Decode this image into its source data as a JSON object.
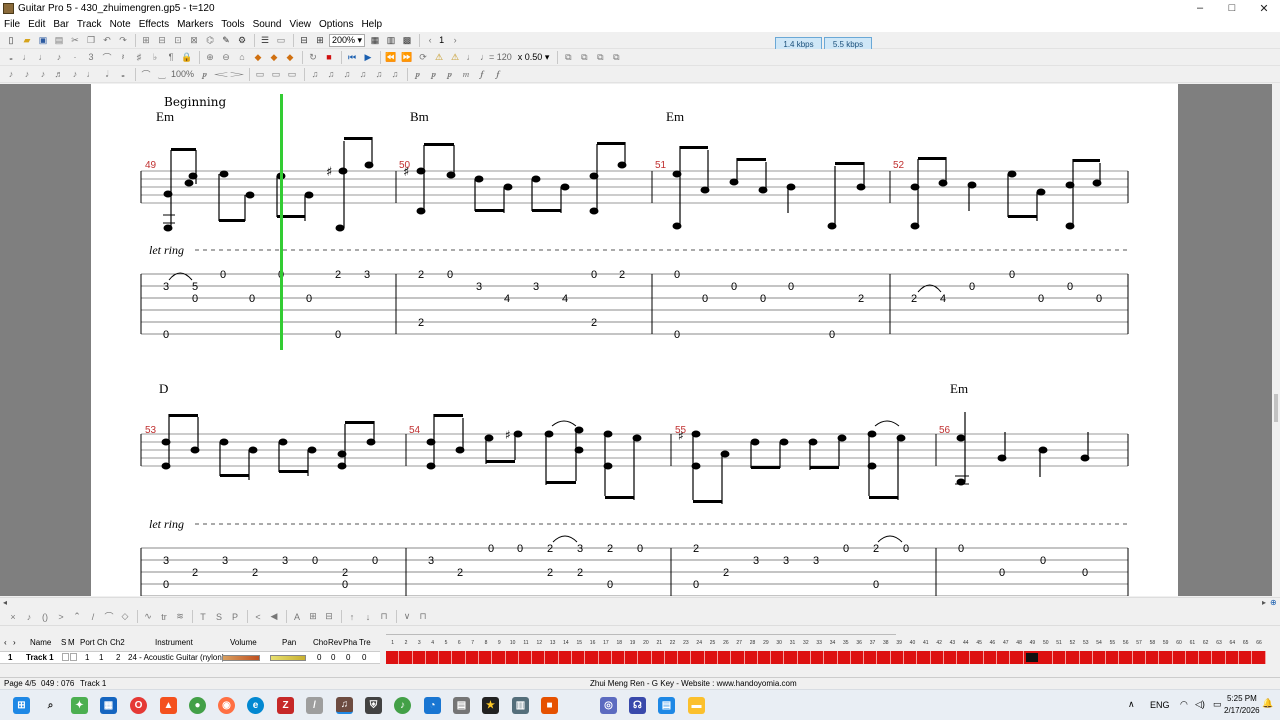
{
  "window": {
    "title": "Guitar Pro 5 - 430_zhuimengren.gp5 - t=120",
    "controls": [
      "–",
      "□",
      "✕"
    ]
  },
  "menu": [
    "File",
    "Edit",
    "Bar",
    "Track",
    "Note",
    "Effects",
    "Markers",
    "Tools",
    "Sound",
    "View",
    "Options",
    "Help"
  ],
  "toolbar": {
    "zoom": "200%",
    "page_number": "1",
    "tempo": "♩= 120",
    "speed": "x 0.50",
    "zoom_step": "100%",
    "kbps_left": "1.4 kbps",
    "kbps_right": "5.5 kbps"
  },
  "score": {
    "section_label": "Beginning",
    "let_ring": "let ring",
    "systems": [
      {
        "measures": [
          {
            "number": "49",
            "chord": "Em"
          },
          {
            "number": "50",
            "chord": "Bm"
          },
          {
            "number": "51",
            "chord": "Em"
          },
          {
            "number": "52",
            "chord": ""
          }
        ]
      },
      {
        "measures": [
          {
            "number": "53",
            "chord": "D"
          },
          {
            "number": "54",
            "chord": ""
          },
          {
            "number": "55",
            "chord": ""
          },
          {
            "number": "56",
            "chord": "Em"
          }
        ]
      }
    ],
    "tab": {
      "system1": [
        [
          "3",
          "5",
          "0",
          "0",
          "0",
          "0",
          "2",
          "3",
          "0",
          "0"
        ],
        [
          "2",
          "0",
          "3",
          "4",
          "3",
          "4",
          "2",
          "0",
          "2",
          "2"
        ],
        [
          "0",
          "0",
          "0",
          "0",
          "0",
          "2",
          "0",
          "0",
          "2",
          "4"
        ],
        [
          "0",
          "0",
          "0",
          "0",
          "0",
          "0"
        ]
      ],
      "system2": [
        [
          "3",
          "2",
          "3",
          "2",
          "3",
          "0",
          "0",
          "2",
          "0",
          "0"
        ],
        [
          "3",
          "2",
          "0",
          "0",
          "2",
          "2",
          "2",
          "3",
          "2",
          "0",
          "0"
        ],
        [
          "2",
          "0",
          "2",
          "3",
          "3",
          "3",
          "0",
          "2",
          "0",
          "0"
        ],
        [
          "0",
          "0",
          "0",
          "0"
        ]
      ]
    }
  },
  "track_panel": {
    "headers": [
      "Name",
      "S",
      "M",
      "Port",
      "Ch",
      "Ch2",
      "Instrument",
      "Volume",
      "Pan",
      "Cho",
      "Rev",
      "Pha",
      "Tre"
    ],
    "track": {
      "index": "1",
      "name": "Track 1",
      "port": "1",
      "ch": "1",
      "ch2": "2",
      "instrument": "24 - Acoustic Guitar (nylon)",
      "cho": "0",
      "rev": "0",
      "pha": "0",
      "tre": "0"
    },
    "bar_count": 66,
    "current_bar": 49
  },
  "status": {
    "page": "Page 4/5",
    "position": "049 : 076",
    "track": "Track 1",
    "song": "Zhui Meng Ren - G Key - Website : www.handoyomia.com"
  },
  "taskbar": {
    "language": "ENG",
    "time": "5:25 PM",
    "date": "2/17/2026",
    "up_arrow": "∧",
    "bell": "🔔"
  },
  "colors": {
    "cursor": "#33cc33",
    "bar_number": "#c03030",
    "timeline_bar": "#dd1111"
  }
}
